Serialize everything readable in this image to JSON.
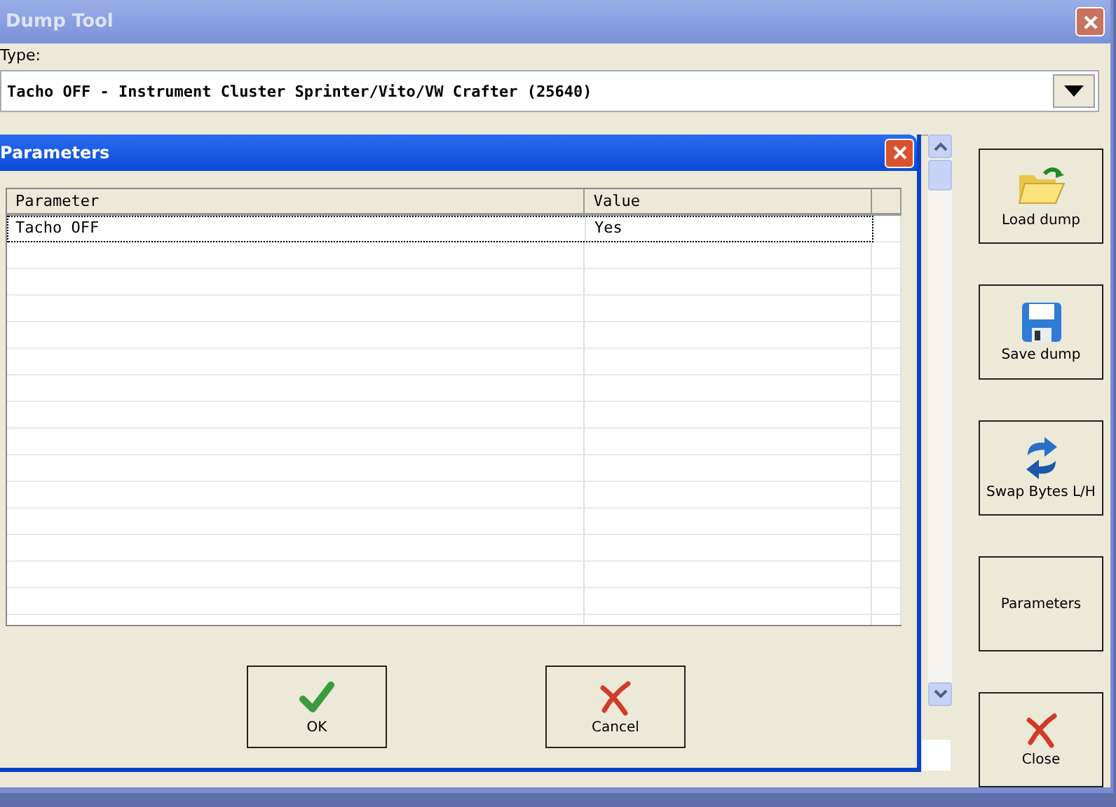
{
  "window": {
    "title": "Dump Tool"
  },
  "type_label": "Type:",
  "type_value": "Tacho OFF - Instrument Cluster Sprinter/Vito/VW Crafter (25640)",
  "side_buttons": [
    {
      "kind": "load",
      "label": "Load dump"
    },
    {
      "kind": "save",
      "label": "Save dump"
    },
    {
      "kind": "swap",
      "label": "Swap Bytes L/H"
    },
    {
      "kind": "none",
      "label": "Parameters"
    },
    {
      "kind": "close",
      "label": "Close"
    }
  ],
  "dialog": {
    "title": "Parameters",
    "table": {
      "columns": [
        "Parameter",
        "Value"
      ],
      "rows": [
        {
          "cells": [
            "Tacho OFF",
            "Yes"
          ],
          "selected": true
        }
      ]
    },
    "buttons": [
      {
        "kind": "ok",
        "label": "OK"
      },
      {
        "kind": "cancel",
        "label": "Cancel"
      }
    ]
  }
}
